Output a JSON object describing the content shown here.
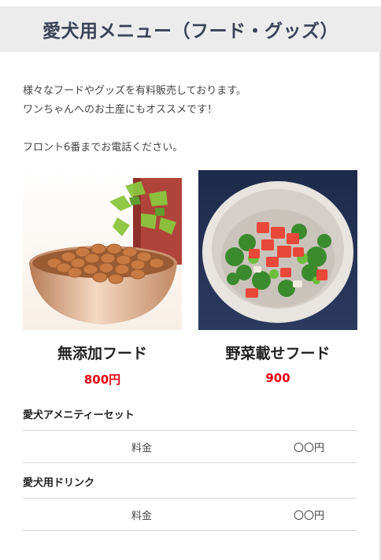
{
  "header": {
    "title": "愛犬用メニュー（フード・グッズ）"
  },
  "intro": {
    "line1": "様々なフードやグッズを有料販売しております。",
    "line2": "ワンちゃんへのお土産にもオススメです！",
    "line3": "フロント6番までお電話ください。"
  },
  "products": [
    {
      "name": "無添加フード",
      "price": "800円"
    },
    {
      "name": "野菜載せフード",
      "price": "900"
    }
  ],
  "menu": [
    {
      "title": "愛犬アメニティーセット",
      "label": "料金",
      "value": "〇〇円"
    },
    {
      "title": "愛犬用ドリンク",
      "label": "料金",
      "value": "〇〇円"
    }
  ],
  "colors": {
    "price": "#e60012",
    "header_bg": "#ececec",
    "title": "#3a4256"
  }
}
